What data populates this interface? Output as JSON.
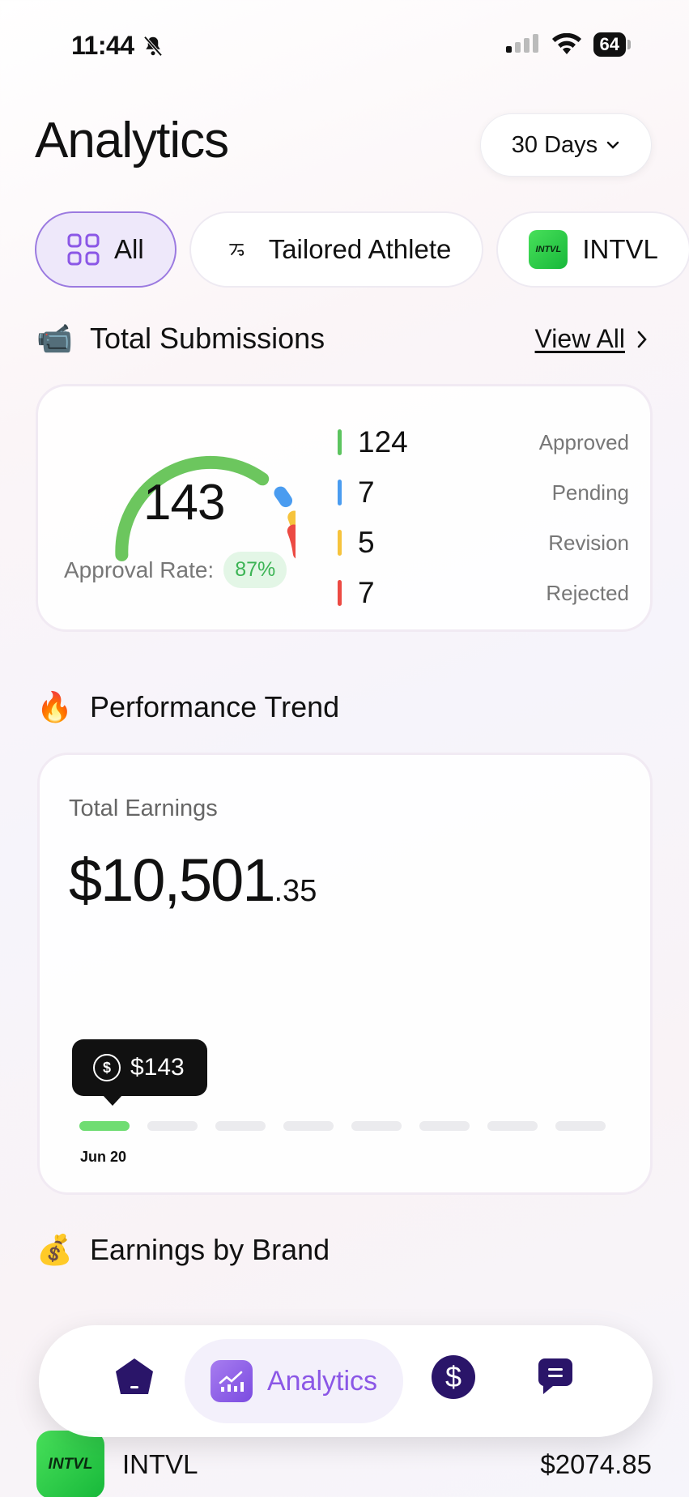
{
  "status_bar": {
    "time": "11:44",
    "battery": "64"
  },
  "header": {
    "title": "Analytics",
    "range_label": "30 Days"
  },
  "filters": [
    {
      "label": "All",
      "icon": "grid-icon",
      "active": true
    },
    {
      "label": "Tailored Athlete",
      "icon": "tailored-athlete-logo",
      "active": false
    },
    {
      "label": "INTVL",
      "icon": "intvl-logo",
      "logo_text": "INTVL",
      "active": false
    }
  ],
  "submissions": {
    "title": "Total Submissions",
    "view_all": "View All",
    "total": "143",
    "approval_label": "Approval Rate:",
    "approval_rate": "87%",
    "stats": [
      {
        "value": "124",
        "label": "Approved",
        "color": "#5cc45f"
      },
      {
        "value": "7",
        "label": "Pending",
        "color": "#4a9cf0"
      },
      {
        "value": "5",
        "label": "Revision",
        "color": "#f6c33c"
      },
      {
        "value": "7",
        "label": "Rejected",
        "color": "#ec4a43"
      }
    ]
  },
  "performance": {
    "title": "Performance Trend",
    "earnings_label": "Total Earnings",
    "earnings_main": "$10,501",
    "earnings_cents": ".35",
    "tooltip_value": "$143",
    "highlight_date": "Jun 20"
  },
  "earnings_by_brand": {
    "title": "Earnings by Brand",
    "brands": [
      {
        "name": "INTVL",
        "amount": "$2074.85",
        "logo_text": "INTVL"
      }
    ]
  },
  "nav": {
    "active_label": "Analytics"
  },
  "colors": {
    "accent": "#8b57e6",
    "approved": "#5cc45f",
    "nav_dark": "#2a1569"
  }
}
